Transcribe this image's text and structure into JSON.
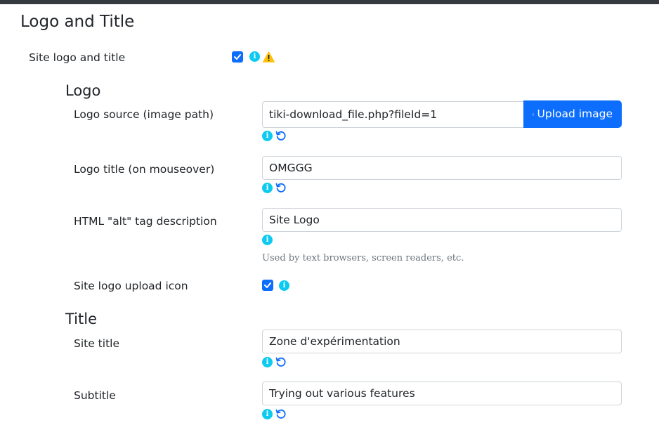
{
  "section_title": "Logo and Title",
  "site_logo_and_title": {
    "label": "Site logo and title",
    "checked": true
  },
  "logo": {
    "heading": "Logo",
    "source": {
      "label": "Logo source (image path)",
      "value": "tiki-download_file.php?fileId=1",
      "button_label": "Upload image"
    },
    "title": {
      "label": "Logo title (on mouseover)",
      "value": "OMGGG"
    },
    "alt": {
      "label": "HTML \"alt\" tag description",
      "value": "Site Logo",
      "hint": "Used by text browsers, screen readers, etc."
    },
    "upload_icon": {
      "label": "Site logo upload icon",
      "checked": true
    }
  },
  "title_section": {
    "heading": "Title",
    "site_title": {
      "label": "Site title",
      "value": "Zone d'expérimentation"
    },
    "subtitle": {
      "label": "Subtitle",
      "value": "Trying out various features"
    }
  },
  "icons": {
    "info": "info-icon",
    "warning": "warning-icon",
    "reset": "reset-icon",
    "checkbox": "check-icon",
    "upload": "image-file-icon"
  },
  "colors": {
    "primary": "#0d6efd",
    "info": "#0dcaf0",
    "warning": "#ffc107",
    "topbar": "#343a40"
  }
}
